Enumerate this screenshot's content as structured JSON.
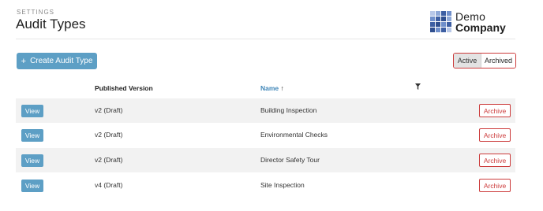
{
  "header": {
    "eyebrow": "SETTINGS",
    "title": "Audit Types"
  },
  "logo": {
    "line1": "Demo",
    "line2": "Company"
  },
  "toolbar": {
    "create_label": "Create Audit Type",
    "create_icon": "plus-icon"
  },
  "status_toggle": {
    "active_label": "Active",
    "archived_label": "Archived",
    "selected": "Active"
  },
  "table": {
    "columns": {
      "published_version": "Published Version",
      "name": "Name",
      "name_sort_icon": "arrow-up-icon",
      "filter_icon": "filter-icon"
    },
    "rows": [
      {
        "view_label": "View",
        "version": "v2 (Draft)",
        "name": "Building Inspection",
        "archive_label": "Archive"
      },
      {
        "view_label": "View",
        "version": "v2 (Draft)",
        "name": "Environmental Checks",
        "archive_label": "Archive"
      },
      {
        "view_label": "View",
        "version": "v2 (Draft)",
        "name": "Director Safety Tour",
        "archive_label": "Archive"
      },
      {
        "view_label": "View",
        "version": "v4 (Draft)",
        "name": "Site Inspection",
        "archive_label": "Archive"
      }
    ]
  },
  "colors": {
    "primary": "#5d9fc5",
    "danger": "#cc3b3b",
    "link": "#3f86b8",
    "logo_blue": "#3d5fa3"
  }
}
